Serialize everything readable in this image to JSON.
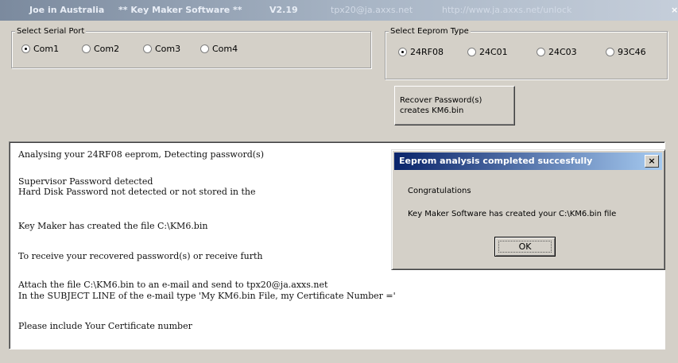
{
  "window": {
    "title_parts": [
      "Joe in Australia",
      "** Key Maker Software **",
      "V2.19",
      "tpx20@ja.axxs.net",
      "http://www.ja.axxs.net/unlock"
    ],
    "close_glyph": "×"
  },
  "serial_port": {
    "legend": "Select Serial Port",
    "options": [
      {
        "label": "Com1",
        "selected": true
      },
      {
        "label": "Com2",
        "selected": false
      },
      {
        "label": "Com3",
        "selected": false
      },
      {
        "label": "Com4",
        "selected": false
      }
    ]
  },
  "eeprom_type": {
    "legend": "Select Eeprom Type",
    "options": [
      {
        "label": "24RF08",
        "selected": true
      },
      {
        "label": "24C01",
        "selected": false
      },
      {
        "label": "24C03",
        "selected": false
      },
      {
        "label": "93C46",
        "selected": false
      }
    ]
  },
  "recover_button": {
    "line1": "Recover Password(s)",
    "line2": "creates  KM6.bin"
  },
  "output": {
    "lines": [
      "Analysing your 24RF08 eeprom, Detecting password(s)",
      "Supervisor Password detected",
      "Hard Disk  Password not detected or not stored in the",
      "Key Maker has created the file  C:\\KM6.bin",
      "To receive your recovered password(s) or receive furth",
      "Attach the file C:\\KM6.bin to an e-mail and send to tpx20@ja.axxs.net",
      "In the SUBJECT LINE of the e-mail type 'My KM6.bin File, my Certificate Number ='",
      "Please include Your Certificate number"
    ]
  },
  "dialog": {
    "title": "Eeprom analysis completed succesfully",
    "close_glyph": "×",
    "message1": "Congratulations",
    "message2": "Key Maker Software has created your C:\\KM6.bin file",
    "ok_label": "OK"
  }
}
